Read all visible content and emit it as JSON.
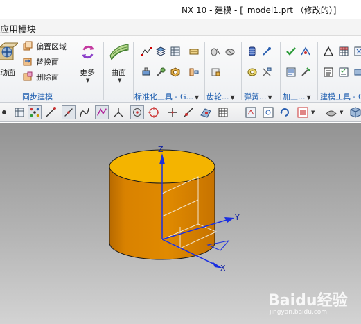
{
  "window": {
    "title": "NX 10 - 建模 - [_model1.prt （修改的）]"
  },
  "menubar": {
    "label": "应用模块"
  },
  "ribbon": {
    "buttons": {
      "move_face": "动面",
      "offset_region": "偏置区域",
      "replace_face": "替换面",
      "delete_face": "删除面",
      "more": "更多",
      "surface": "曲面"
    },
    "groups": {
      "sync_modeling": "同步建模",
      "standard_tools": "标准化工具 - G...",
      "gear": "齿轮...",
      "spring": "弹簧...",
      "machining": "加工...",
      "modeling_tools": "建模工具 - G"
    }
  },
  "viewport": {
    "axes": {
      "z": "Z",
      "y": "Y",
      "x": "X"
    },
    "colors": {
      "cylinder_side": "#E08A00",
      "cylinder_top": "#F4B400",
      "axis": "#1A2FE0"
    }
  },
  "watermark": {
    "brand": "Baidu经验",
    "url": "jingyan.baidu.com"
  }
}
